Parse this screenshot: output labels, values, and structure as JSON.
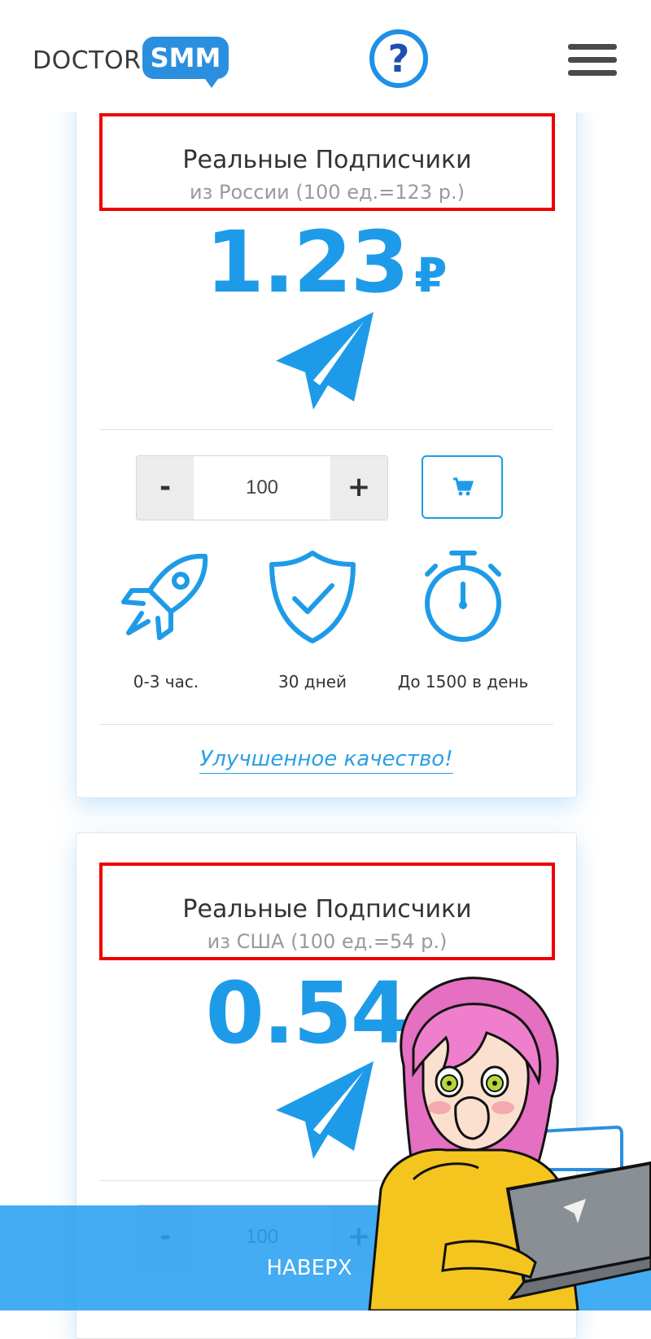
{
  "header": {
    "logo_left": "DOCTOR",
    "logo_right": "SMM",
    "help_icon": "question-circle-icon",
    "menu_icon": "hamburger-menu-icon"
  },
  "colors": {
    "accent": "#1e9be8",
    "highlight_border": "#ee0000",
    "bottom_bar": "#29a0f0"
  },
  "cards": [
    {
      "title": "Реальные Подписчики",
      "subtitle": "из России (100 ед.=123 р.)",
      "price": "1.23",
      "currency": "₽",
      "icon": "telegram-plane-icon",
      "quantity": "100",
      "minus_label": "-",
      "plus_label": "+",
      "cart_icon": "cart-icon",
      "features": [
        {
          "icon": "rocket-icon",
          "label": "0-3 час."
        },
        {
          "icon": "shield-check-icon",
          "label": "30 дней"
        },
        {
          "icon": "stopwatch-icon",
          "label": "До 1500 в день"
        }
      ],
      "link": "Улучшенное качество!"
    },
    {
      "title": "Реальные Подписчики",
      "subtitle": "из США (100 ед.=54 р.)",
      "price": "0.54",
      "currency": "₽",
      "icon": "telegram-plane-icon",
      "quantity": "100",
      "minus_label": "-",
      "plus_label": "+"
    }
  ],
  "bottom_bar": {
    "label": "НАВЕРХ"
  },
  "mascot": {
    "description_icon": "mascot-girl-laptop-icon"
  }
}
